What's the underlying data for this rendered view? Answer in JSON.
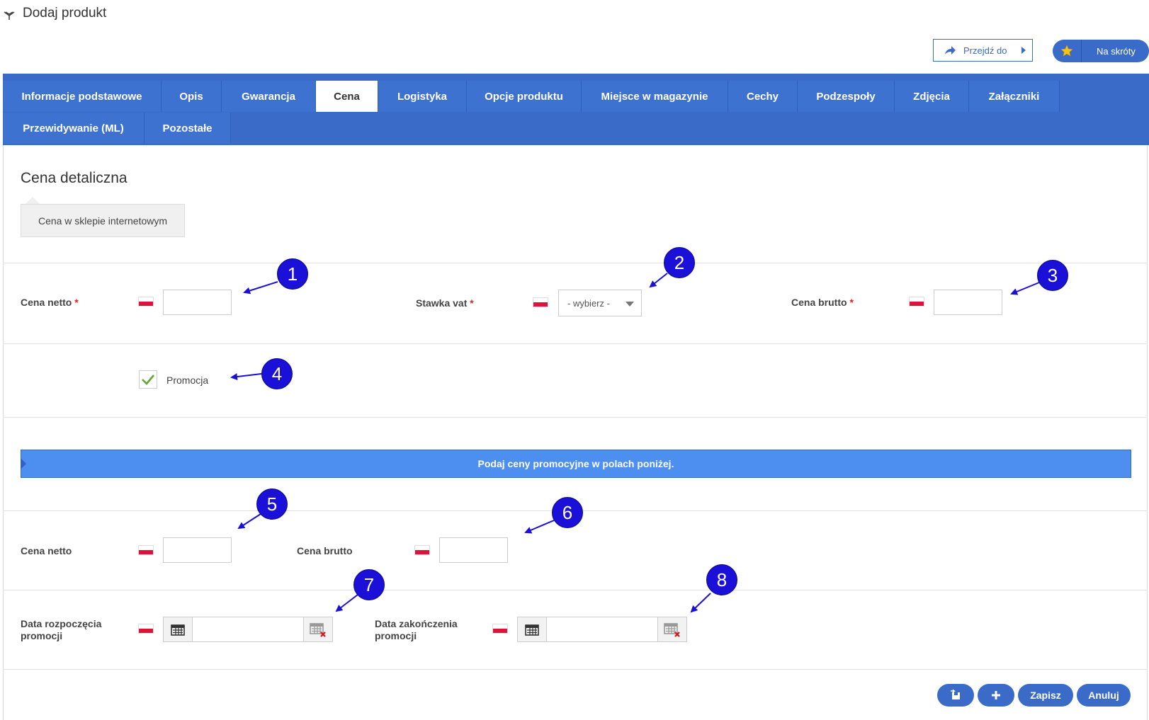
{
  "header": {
    "title": "Dodaj produkt",
    "goto_label": "Przejdź do",
    "shortcuts_label": "Na skróty"
  },
  "tabs": [
    {
      "label": "Informacje podstawowe"
    },
    {
      "label": "Opis"
    },
    {
      "label": "Gwarancja"
    },
    {
      "label": "Cena",
      "active": true
    },
    {
      "label": "Logistyka"
    },
    {
      "label": "Opcje produktu"
    },
    {
      "label": "Miejsce w magazynie"
    },
    {
      "label": "Cechy"
    },
    {
      "label": "Podzespoły"
    },
    {
      "label": "Zdjęcia"
    },
    {
      "label": "Załączniki"
    },
    {
      "label": "Przewidywanie (ML)"
    },
    {
      "label": "Pozostałe"
    }
  ],
  "section": {
    "title": "Cena detaliczna",
    "subtab": "Cena w sklepie internetowym"
  },
  "form": {
    "net_label": "Cena netto",
    "vat_label": "Stawka vat",
    "vat_placeholder": "- wybierz -",
    "gross_label": "Cena brutto",
    "required_mark": "*",
    "promo_label": "Promocja",
    "promo_checked": true,
    "banner": "Podaj ceny promocyjne w polach poniżej.",
    "promo_net_label": "Cena netto",
    "promo_gross_label": "Cena brutto",
    "start_label": "Data rozpoczęcia promocji",
    "end_label": "Data zakończenia promocji"
  },
  "annotations": [
    "1",
    "2",
    "3",
    "4",
    "5",
    "6",
    "7",
    "8"
  ],
  "footer": {
    "save_label": "Zapisz",
    "cancel_label": "Anuluj"
  },
  "colors": {
    "primary": "#3a6bc9",
    "banner": "#4d8ff0",
    "annotation": "#1a10d8",
    "required": "#dd2222"
  }
}
